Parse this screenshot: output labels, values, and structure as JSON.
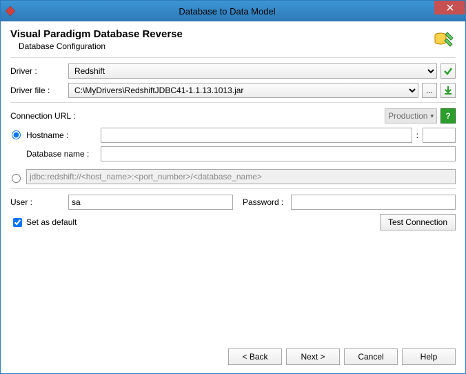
{
  "window": {
    "title": "Database to Data Model"
  },
  "header": {
    "title": "Visual Paradigm Database Reverse",
    "subtitle": "Database Configuration"
  },
  "labels": {
    "driver": "Driver :",
    "driver_file": "Driver file :",
    "connection_url": "Connection URL :",
    "hostname": "Hostname :",
    "port_sep": ":",
    "database_name": "Database name :",
    "user": "User :",
    "password": "Password :",
    "set_default": "Set as default",
    "url_template": "jdbc:redshift://<host_name>:<port_number>/<database_name>"
  },
  "values": {
    "driver": "Redshift",
    "driver_file": "C:\\MyDrivers\\RedshiftJDBC41-1.1.13.1013.jar",
    "env": "Production",
    "hostname": "",
    "port": "",
    "database_name": "",
    "user": "sa",
    "password": "",
    "set_default": true
  },
  "buttons": {
    "browse": "...",
    "test_connection": "Test Connection",
    "back": "< Back",
    "next": "Next >",
    "cancel": "Cancel",
    "help": "Help"
  }
}
